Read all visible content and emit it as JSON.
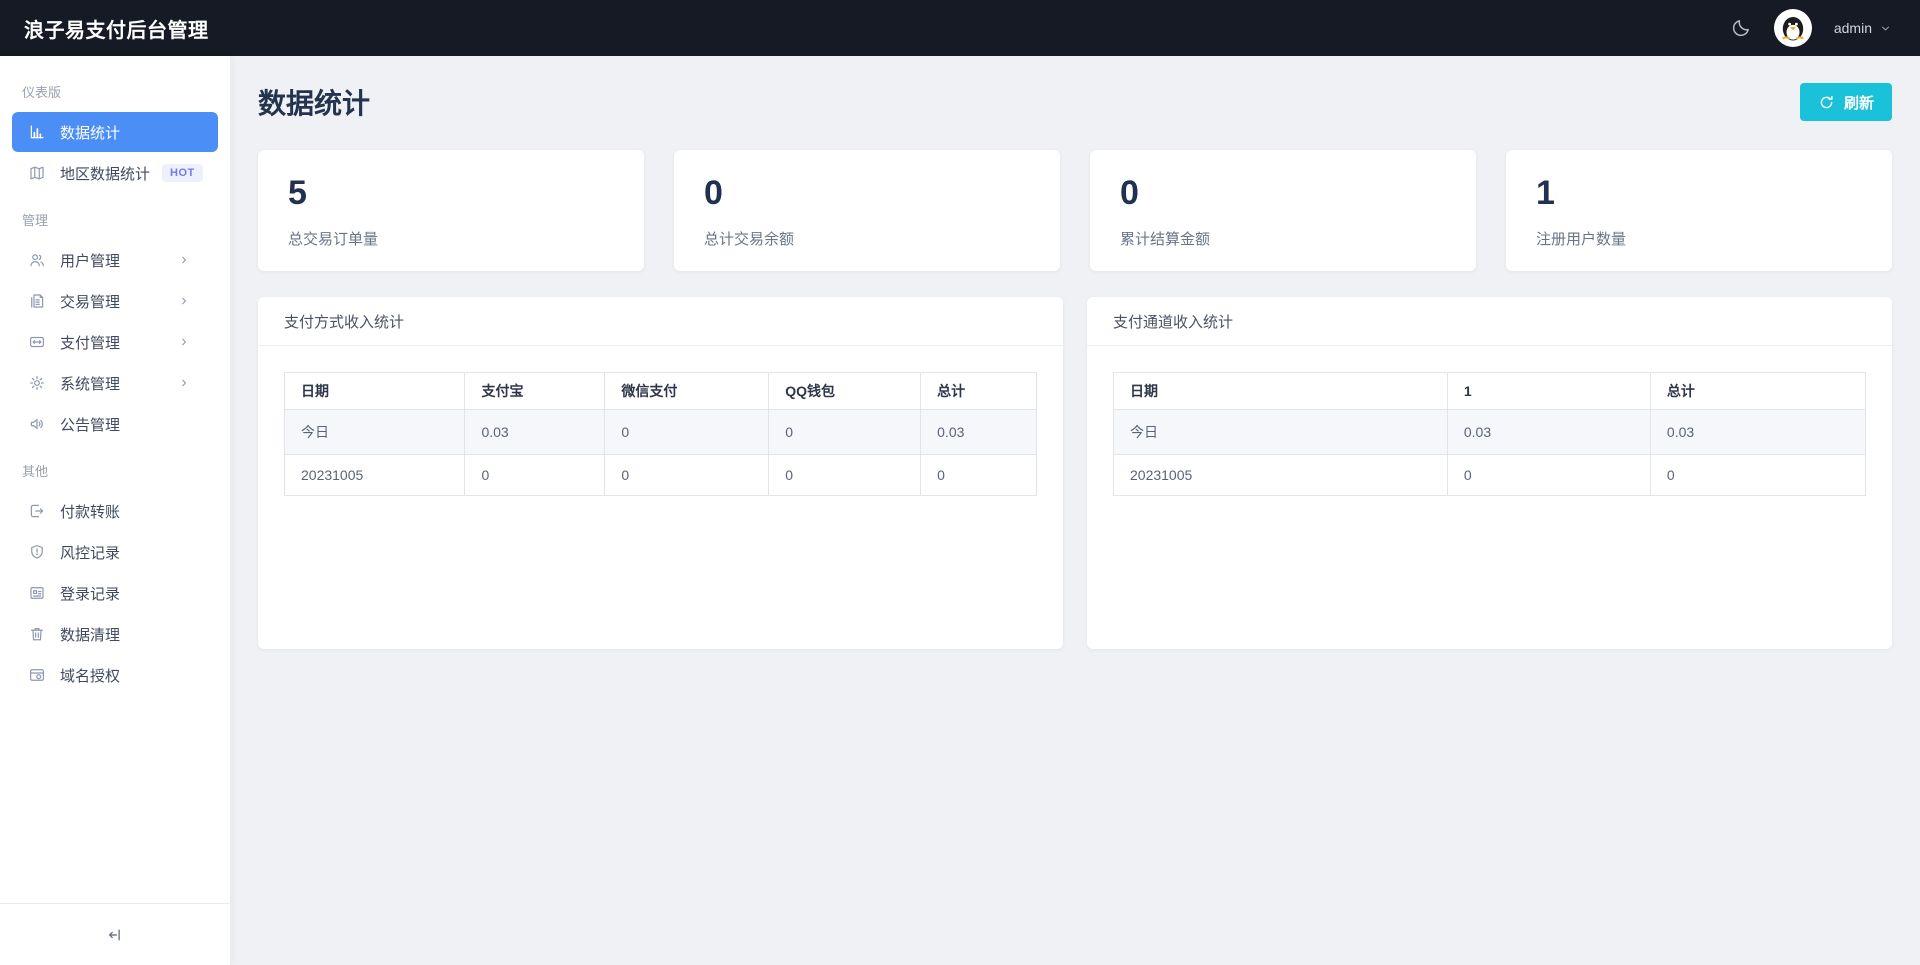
{
  "header": {
    "title": "浪子易支付后台管理",
    "theme_icon": "moon-icon",
    "avatar_icon": "penguin-avatar",
    "user": "admin",
    "user_chevron_icon": "chevron-down-icon"
  },
  "sidebar": {
    "sections": [
      {
        "label": "仪表版",
        "items": [
          {
            "label": "数据统计",
            "icon": "bar-chart-icon",
            "active": true
          },
          {
            "label": "地区数据统计",
            "icon": "map-icon",
            "badge": "HOT"
          }
        ]
      },
      {
        "label": "管理",
        "items": [
          {
            "label": "用户管理",
            "icon": "users-icon",
            "chevron": true
          },
          {
            "label": "交易管理",
            "icon": "file-text-icon",
            "chevron": true
          },
          {
            "label": "支付管理",
            "icon": "transaction-icon",
            "chevron": true
          },
          {
            "label": "系统管理",
            "icon": "gear-icon",
            "chevron": true
          },
          {
            "label": "公告管理",
            "icon": "sound-icon"
          }
        ]
      },
      {
        "label": "其他",
        "items": [
          {
            "label": "付款转账",
            "icon": "export-icon"
          },
          {
            "label": "风控记录",
            "icon": "shield-alert-icon"
          },
          {
            "label": "登录记录",
            "icon": "idcard-icon"
          },
          {
            "label": "数据清理",
            "icon": "trash-icon"
          },
          {
            "label": "域名授权",
            "icon": "browser-icon"
          }
        ]
      }
    ],
    "collapse_icon": "collapse-to-left-icon"
  },
  "main": {
    "page_title": "数据统计",
    "refresh_label": "刷新",
    "refresh_icon": "refresh-icon",
    "stats": [
      {
        "value": "5",
        "label": "总交易订单量"
      },
      {
        "value": "0",
        "label": "总计交易余额"
      },
      {
        "value": "0",
        "label": "累计结算金额"
      },
      {
        "value": "1",
        "label": "注册用户数量"
      }
    ],
    "tables": [
      {
        "title": "支付方式收入统计",
        "headers": [
          "日期",
          "支付宝",
          "微信支付",
          "QQ钱包",
          "总计"
        ],
        "rows": [
          [
            "今日",
            "0.03",
            "0",
            "0",
            "0.03"
          ],
          [
            "20231005",
            "0",
            "0",
            "0",
            "0"
          ]
        ]
      },
      {
        "title": "支付通道收入统计",
        "headers": [
          "日期",
          "1",
          "总计"
        ],
        "rows": [
          [
            "今日",
            "0.03",
            "0.03"
          ],
          [
            "20231005",
            "0",
            "0"
          ]
        ]
      }
    ]
  },
  "colors": {
    "header_bg": "#151a24",
    "accent": "#4b8ef5",
    "refresh_button": "#19c2d8",
    "hot_badge_bg": "#eef0fc",
    "hot_badge_text": "#6d7bf2"
  }
}
